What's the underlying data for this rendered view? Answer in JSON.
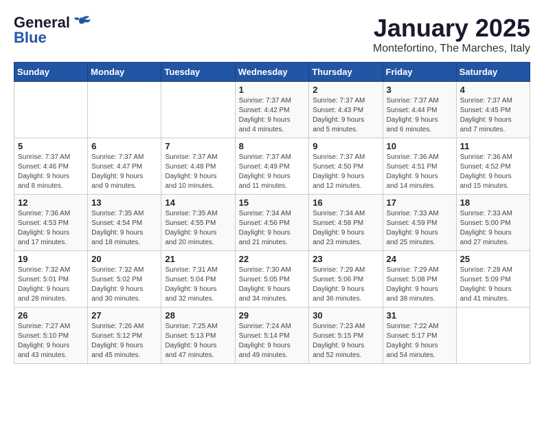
{
  "logo": {
    "text_general": "General",
    "text_blue": "Blue"
  },
  "title": "January 2025",
  "subtitle": "Montefortino, The Marches, Italy",
  "weekdays": [
    "Sunday",
    "Monday",
    "Tuesday",
    "Wednesday",
    "Thursday",
    "Friday",
    "Saturday"
  ],
  "weeks": [
    [
      {
        "day": "",
        "info": ""
      },
      {
        "day": "",
        "info": ""
      },
      {
        "day": "",
        "info": ""
      },
      {
        "day": "1",
        "info": "Sunrise: 7:37 AM\nSunset: 4:42 PM\nDaylight: 9 hours\nand 4 minutes."
      },
      {
        "day": "2",
        "info": "Sunrise: 7:37 AM\nSunset: 4:43 PM\nDaylight: 9 hours\nand 5 minutes."
      },
      {
        "day": "3",
        "info": "Sunrise: 7:37 AM\nSunset: 4:44 PM\nDaylight: 9 hours\nand 6 minutes."
      },
      {
        "day": "4",
        "info": "Sunrise: 7:37 AM\nSunset: 4:45 PM\nDaylight: 9 hours\nand 7 minutes."
      }
    ],
    [
      {
        "day": "5",
        "info": "Sunrise: 7:37 AM\nSunset: 4:46 PM\nDaylight: 9 hours\nand 8 minutes."
      },
      {
        "day": "6",
        "info": "Sunrise: 7:37 AM\nSunset: 4:47 PM\nDaylight: 9 hours\nand 9 minutes."
      },
      {
        "day": "7",
        "info": "Sunrise: 7:37 AM\nSunset: 4:48 PM\nDaylight: 9 hours\nand 10 minutes."
      },
      {
        "day": "8",
        "info": "Sunrise: 7:37 AM\nSunset: 4:49 PM\nDaylight: 9 hours\nand 11 minutes."
      },
      {
        "day": "9",
        "info": "Sunrise: 7:37 AM\nSunset: 4:50 PM\nDaylight: 9 hours\nand 12 minutes."
      },
      {
        "day": "10",
        "info": "Sunrise: 7:36 AM\nSunset: 4:51 PM\nDaylight: 9 hours\nand 14 minutes."
      },
      {
        "day": "11",
        "info": "Sunrise: 7:36 AM\nSunset: 4:52 PM\nDaylight: 9 hours\nand 15 minutes."
      }
    ],
    [
      {
        "day": "12",
        "info": "Sunrise: 7:36 AM\nSunset: 4:53 PM\nDaylight: 9 hours\nand 17 minutes."
      },
      {
        "day": "13",
        "info": "Sunrise: 7:35 AM\nSunset: 4:54 PM\nDaylight: 9 hours\nand 18 minutes."
      },
      {
        "day": "14",
        "info": "Sunrise: 7:35 AM\nSunset: 4:55 PM\nDaylight: 9 hours\nand 20 minutes."
      },
      {
        "day": "15",
        "info": "Sunrise: 7:34 AM\nSunset: 4:56 PM\nDaylight: 9 hours\nand 21 minutes."
      },
      {
        "day": "16",
        "info": "Sunrise: 7:34 AM\nSunset: 4:58 PM\nDaylight: 9 hours\nand 23 minutes."
      },
      {
        "day": "17",
        "info": "Sunrise: 7:33 AM\nSunset: 4:59 PM\nDaylight: 9 hours\nand 25 minutes."
      },
      {
        "day": "18",
        "info": "Sunrise: 7:33 AM\nSunset: 5:00 PM\nDaylight: 9 hours\nand 27 minutes."
      }
    ],
    [
      {
        "day": "19",
        "info": "Sunrise: 7:32 AM\nSunset: 5:01 PM\nDaylight: 9 hours\nand 28 minutes."
      },
      {
        "day": "20",
        "info": "Sunrise: 7:32 AM\nSunset: 5:02 PM\nDaylight: 9 hours\nand 30 minutes."
      },
      {
        "day": "21",
        "info": "Sunrise: 7:31 AM\nSunset: 5:04 PM\nDaylight: 9 hours\nand 32 minutes."
      },
      {
        "day": "22",
        "info": "Sunrise: 7:30 AM\nSunset: 5:05 PM\nDaylight: 9 hours\nand 34 minutes."
      },
      {
        "day": "23",
        "info": "Sunrise: 7:29 AM\nSunset: 5:06 PM\nDaylight: 9 hours\nand 36 minutes."
      },
      {
        "day": "24",
        "info": "Sunrise: 7:29 AM\nSunset: 5:08 PM\nDaylight: 9 hours\nand 38 minutes."
      },
      {
        "day": "25",
        "info": "Sunrise: 7:28 AM\nSunset: 5:09 PM\nDaylight: 9 hours\nand 41 minutes."
      }
    ],
    [
      {
        "day": "26",
        "info": "Sunrise: 7:27 AM\nSunset: 5:10 PM\nDaylight: 9 hours\nand 43 minutes."
      },
      {
        "day": "27",
        "info": "Sunrise: 7:26 AM\nSunset: 5:12 PM\nDaylight: 9 hours\nand 45 minutes."
      },
      {
        "day": "28",
        "info": "Sunrise: 7:25 AM\nSunset: 5:13 PM\nDaylight: 9 hours\nand 47 minutes."
      },
      {
        "day": "29",
        "info": "Sunrise: 7:24 AM\nSunset: 5:14 PM\nDaylight: 9 hours\nand 49 minutes."
      },
      {
        "day": "30",
        "info": "Sunrise: 7:23 AM\nSunset: 5:15 PM\nDaylight: 9 hours\nand 52 minutes."
      },
      {
        "day": "31",
        "info": "Sunrise: 7:22 AM\nSunset: 5:17 PM\nDaylight: 9 hours\nand 54 minutes."
      },
      {
        "day": "",
        "info": ""
      }
    ]
  ]
}
